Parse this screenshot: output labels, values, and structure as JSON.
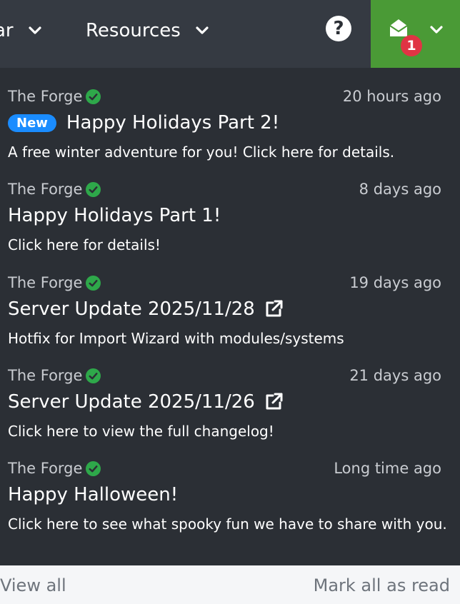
{
  "nav": {
    "partial_label": "ar",
    "resources_label": "Resources",
    "help_icon": "question-circle-icon",
    "notifications": {
      "icon": "envelope-open-icon",
      "count": "1",
      "color": "#4a9a36",
      "badge_color": "#e03444"
    }
  },
  "notifications": [
    {
      "source": "The Forge",
      "time": "20 hours ago",
      "badge": "New",
      "title": "Happy Holidays Part 2!",
      "description": "A free winter adventure for you! Click here for details."
    },
    {
      "source": "The Forge",
      "time": "8 days ago",
      "title": "Happy Holidays Part 1!",
      "description": "Click here for details!"
    },
    {
      "source": "The Forge",
      "time": "19 days ago",
      "title": "Server Update 2025/11/28",
      "external_icon": "external-link-icon",
      "description": "Hotfix for Import Wizard with modules/systems"
    },
    {
      "source": "The Forge",
      "time": "21 days ago",
      "title": "Server Update 2025/11/26",
      "external_icon": "external-link-icon",
      "description": "Click here to view the full changelog!"
    },
    {
      "source": "The Forge",
      "time": "Long time ago",
      "title": "Happy Halloween!",
      "description": "Click here to see what spooky fun we have to share with you."
    }
  ],
  "footer": {
    "view_all": "View all",
    "mark_all_read": "Mark all as read"
  },
  "colors": {
    "verified": "#2ea84a",
    "new_badge": "#1a8cff"
  }
}
